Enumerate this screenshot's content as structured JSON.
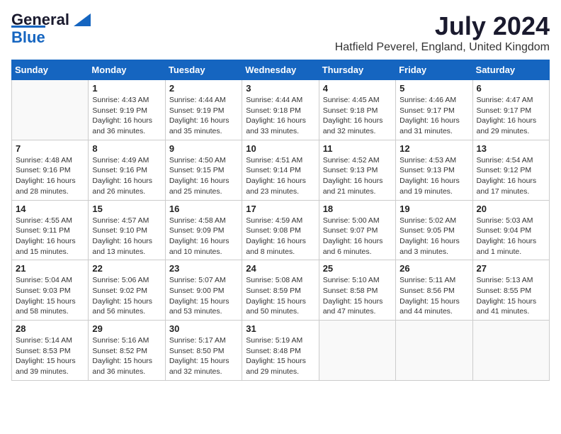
{
  "header": {
    "logo_line1": "General",
    "logo_line2": "Blue",
    "month_year": "July 2024",
    "location": "Hatfield Peverel, England, United Kingdom"
  },
  "weekdays": [
    "Sunday",
    "Monday",
    "Tuesday",
    "Wednesday",
    "Thursday",
    "Friday",
    "Saturday"
  ],
  "weeks": [
    [
      {
        "day": "",
        "sunrise": "",
        "sunset": "",
        "daylight": ""
      },
      {
        "day": "1",
        "sunrise": "Sunrise: 4:43 AM",
        "sunset": "Sunset: 9:19 PM",
        "daylight": "Daylight: 16 hours and 36 minutes."
      },
      {
        "day": "2",
        "sunrise": "Sunrise: 4:44 AM",
        "sunset": "Sunset: 9:19 PM",
        "daylight": "Daylight: 16 hours and 35 minutes."
      },
      {
        "day": "3",
        "sunrise": "Sunrise: 4:44 AM",
        "sunset": "Sunset: 9:18 PM",
        "daylight": "Daylight: 16 hours and 33 minutes."
      },
      {
        "day": "4",
        "sunrise": "Sunrise: 4:45 AM",
        "sunset": "Sunset: 9:18 PM",
        "daylight": "Daylight: 16 hours and 32 minutes."
      },
      {
        "day": "5",
        "sunrise": "Sunrise: 4:46 AM",
        "sunset": "Sunset: 9:17 PM",
        "daylight": "Daylight: 16 hours and 31 minutes."
      },
      {
        "day": "6",
        "sunrise": "Sunrise: 4:47 AM",
        "sunset": "Sunset: 9:17 PM",
        "daylight": "Daylight: 16 hours and 29 minutes."
      }
    ],
    [
      {
        "day": "7",
        "sunrise": "Sunrise: 4:48 AM",
        "sunset": "Sunset: 9:16 PM",
        "daylight": "Daylight: 16 hours and 28 minutes."
      },
      {
        "day": "8",
        "sunrise": "Sunrise: 4:49 AM",
        "sunset": "Sunset: 9:16 PM",
        "daylight": "Daylight: 16 hours and 26 minutes."
      },
      {
        "day": "9",
        "sunrise": "Sunrise: 4:50 AM",
        "sunset": "Sunset: 9:15 PM",
        "daylight": "Daylight: 16 hours and 25 minutes."
      },
      {
        "day": "10",
        "sunrise": "Sunrise: 4:51 AM",
        "sunset": "Sunset: 9:14 PM",
        "daylight": "Daylight: 16 hours and 23 minutes."
      },
      {
        "day": "11",
        "sunrise": "Sunrise: 4:52 AM",
        "sunset": "Sunset: 9:13 PM",
        "daylight": "Daylight: 16 hours and 21 minutes."
      },
      {
        "day": "12",
        "sunrise": "Sunrise: 4:53 AM",
        "sunset": "Sunset: 9:13 PM",
        "daylight": "Daylight: 16 hours and 19 minutes."
      },
      {
        "day": "13",
        "sunrise": "Sunrise: 4:54 AM",
        "sunset": "Sunset: 9:12 PM",
        "daylight": "Daylight: 16 hours and 17 minutes."
      }
    ],
    [
      {
        "day": "14",
        "sunrise": "Sunrise: 4:55 AM",
        "sunset": "Sunset: 9:11 PM",
        "daylight": "Daylight: 16 hours and 15 minutes."
      },
      {
        "day": "15",
        "sunrise": "Sunrise: 4:57 AM",
        "sunset": "Sunset: 9:10 PM",
        "daylight": "Daylight: 16 hours and 13 minutes."
      },
      {
        "day": "16",
        "sunrise": "Sunrise: 4:58 AM",
        "sunset": "Sunset: 9:09 PM",
        "daylight": "Daylight: 16 hours and 10 minutes."
      },
      {
        "day": "17",
        "sunrise": "Sunrise: 4:59 AM",
        "sunset": "Sunset: 9:08 PM",
        "daylight": "Daylight: 16 hours and 8 minutes."
      },
      {
        "day": "18",
        "sunrise": "Sunrise: 5:00 AM",
        "sunset": "Sunset: 9:07 PM",
        "daylight": "Daylight: 16 hours and 6 minutes."
      },
      {
        "day": "19",
        "sunrise": "Sunrise: 5:02 AM",
        "sunset": "Sunset: 9:05 PM",
        "daylight": "Daylight: 16 hours and 3 minutes."
      },
      {
        "day": "20",
        "sunrise": "Sunrise: 5:03 AM",
        "sunset": "Sunset: 9:04 PM",
        "daylight": "Daylight: 16 hours and 1 minute."
      }
    ],
    [
      {
        "day": "21",
        "sunrise": "Sunrise: 5:04 AM",
        "sunset": "Sunset: 9:03 PM",
        "daylight": "Daylight: 15 hours and 58 minutes."
      },
      {
        "day": "22",
        "sunrise": "Sunrise: 5:06 AM",
        "sunset": "Sunset: 9:02 PM",
        "daylight": "Daylight: 15 hours and 56 minutes."
      },
      {
        "day": "23",
        "sunrise": "Sunrise: 5:07 AM",
        "sunset": "Sunset: 9:00 PM",
        "daylight": "Daylight: 15 hours and 53 minutes."
      },
      {
        "day": "24",
        "sunrise": "Sunrise: 5:08 AM",
        "sunset": "Sunset: 8:59 PM",
        "daylight": "Daylight: 15 hours and 50 minutes."
      },
      {
        "day": "25",
        "sunrise": "Sunrise: 5:10 AM",
        "sunset": "Sunset: 8:58 PM",
        "daylight": "Daylight: 15 hours and 47 minutes."
      },
      {
        "day": "26",
        "sunrise": "Sunrise: 5:11 AM",
        "sunset": "Sunset: 8:56 PM",
        "daylight": "Daylight: 15 hours and 44 minutes."
      },
      {
        "day": "27",
        "sunrise": "Sunrise: 5:13 AM",
        "sunset": "Sunset: 8:55 PM",
        "daylight": "Daylight: 15 hours and 41 minutes."
      }
    ],
    [
      {
        "day": "28",
        "sunrise": "Sunrise: 5:14 AM",
        "sunset": "Sunset: 8:53 PM",
        "daylight": "Daylight: 15 hours and 39 minutes."
      },
      {
        "day": "29",
        "sunrise": "Sunrise: 5:16 AM",
        "sunset": "Sunset: 8:52 PM",
        "daylight": "Daylight: 15 hours and 36 minutes."
      },
      {
        "day": "30",
        "sunrise": "Sunrise: 5:17 AM",
        "sunset": "Sunset: 8:50 PM",
        "daylight": "Daylight: 15 hours and 32 minutes."
      },
      {
        "day": "31",
        "sunrise": "Sunrise: 5:19 AM",
        "sunset": "Sunset: 8:48 PM",
        "daylight": "Daylight: 15 hours and 29 minutes."
      },
      {
        "day": "",
        "sunrise": "",
        "sunset": "",
        "daylight": ""
      },
      {
        "day": "",
        "sunrise": "",
        "sunset": "",
        "daylight": ""
      },
      {
        "day": "",
        "sunrise": "",
        "sunset": "",
        "daylight": ""
      }
    ]
  ]
}
